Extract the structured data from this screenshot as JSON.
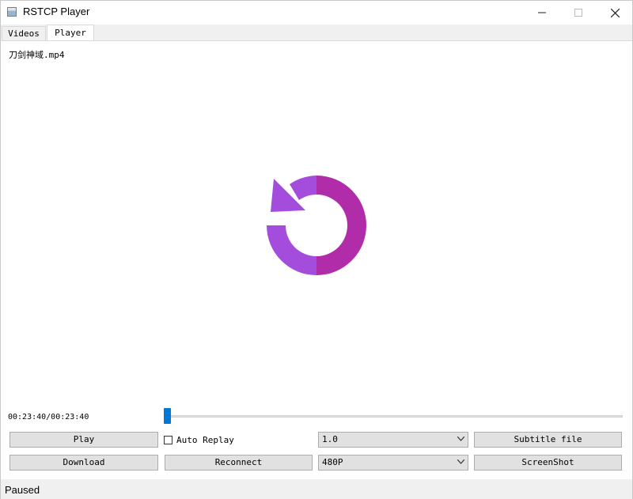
{
  "window": {
    "title": "RSTCP Player"
  },
  "tabs": [
    {
      "label": "Videos",
      "active": false
    },
    {
      "label": "Player",
      "active": true
    }
  ],
  "player": {
    "file_name": "刀剑神域.mp4",
    "time_display": "00:23:40/00:23:40",
    "progress_fraction": 0.0,
    "replay_icon_colors": {
      "left": "#a44cdc",
      "right": "#b02ca8"
    }
  },
  "controls": {
    "play_label": "Play",
    "auto_replay_label": "Auto Replay",
    "auto_replay_checked": false,
    "speed_value": "1.0",
    "subtitle_label": "Subtitle file",
    "download_label": "Download",
    "reconnect_label": "Reconnect",
    "quality_value": "480P",
    "screenshot_label": "ScreenShot"
  },
  "status": {
    "text": "Paused"
  },
  "colors": {
    "accent": "#0078d7"
  }
}
